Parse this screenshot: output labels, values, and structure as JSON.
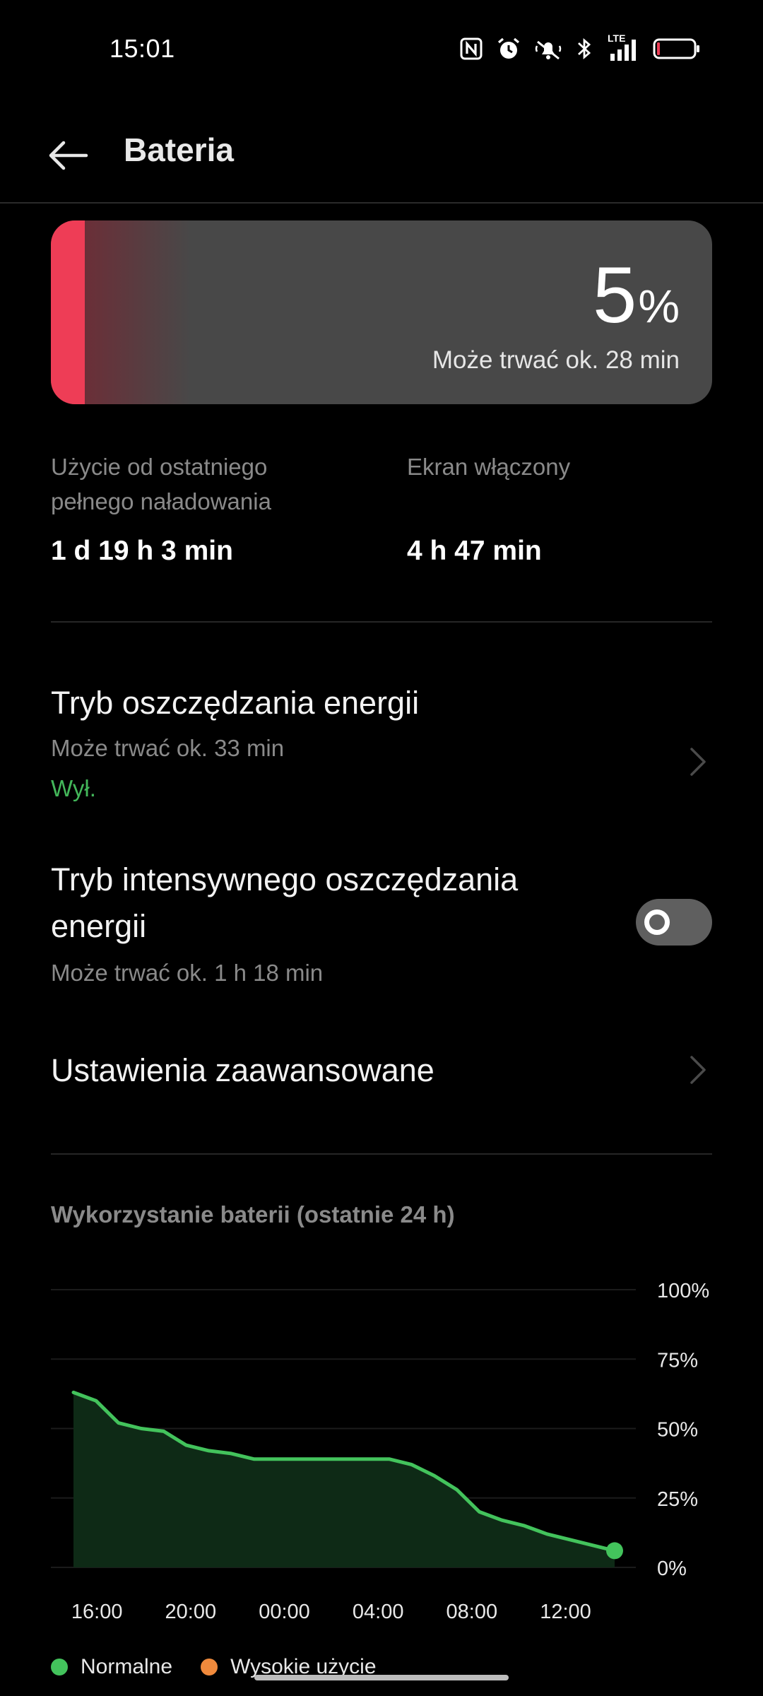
{
  "status_bar": {
    "time": "15:01",
    "icons": [
      "nfc-icon",
      "alarm-icon",
      "mute-icon",
      "bluetooth-icon",
      "lte-signal-icon",
      "battery-low-icon"
    ],
    "network_label": "LTE",
    "battery_level": 0.05
  },
  "header": {
    "title": "Bateria",
    "back_icon": "arrow-left-icon"
  },
  "battery": {
    "percent_value": "5",
    "percent_sign": "%",
    "level": 0.05,
    "estimate": "Może trwać ok. 28 min",
    "accent_color": "#ee3d56"
  },
  "stats": {
    "usage_label": "Użycie od ostatniego pełnego naładowania",
    "usage_value": "1 d 19 h 3 min",
    "screen_label": "Ekran włączony",
    "screen_value": "4 h 47 min"
  },
  "settings": {
    "power_saving": {
      "title": "Tryb oszczędzania energii",
      "subtitle": "Może trwać ok. 33 min",
      "status": "Wył.",
      "status_color": "#43b75a"
    },
    "super_saving": {
      "title": "Tryb intensywnego oszczędzania energii",
      "subtitle": "Może trwać ok. 1 h 18 min",
      "enabled": false
    },
    "advanced": {
      "title": "Ustawienia zaawansowane"
    }
  },
  "chart_section": {
    "title": "Wykorzystanie baterii (ostatnie 24 h)"
  },
  "chart_data": {
    "type": "area",
    "x_tick_labels": [
      "16:00",
      "20:00",
      "00:00",
      "04:00",
      "08:00",
      "12:00"
    ],
    "y_tick_labels": [
      "100%",
      "75%",
      "50%",
      "25%",
      "0%"
    ],
    "ylim": [
      0,
      100
    ],
    "xlim": [
      "15:00",
      "15:01"
    ],
    "grid": true,
    "series": [
      {
        "name": "Normalne",
        "color": "#43c35c",
        "x": [
          "15:00",
          "16:00",
          "17:00",
          "18:00",
          "19:00",
          "20:00",
          "21:00",
          "22:00",
          "23:00",
          "00:00",
          "01:00",
          "02:00",
          "03:00",
          "04:00",
          "05:00",
          "06:00",
          "07:00",
          "08:00",
          "09:00",
          "10:00",
          "11:00",
          "12:00",
          "13:00",
          "14:00",
          "15:00"
        ],
        "values": [
          63,
          60,
          52,
          50,
          49,
          44,
          42,
          41,
          39,
          39,
          39,
          39,
          39,
          39,
          39,
          37,
          33,
          28,
          20,
          17,
          15,
          12,
          10,
          8,
          6
        ]
      }
    ],
    "legend": [
      {
        "name": "Normalne",
        "color": "#43c35c"
      },
      {
        "name": "Wysokie użycie",
        "color": "#f08a3c"
      }
    ],
    "legend_position": "bottom-left"
  }
}
